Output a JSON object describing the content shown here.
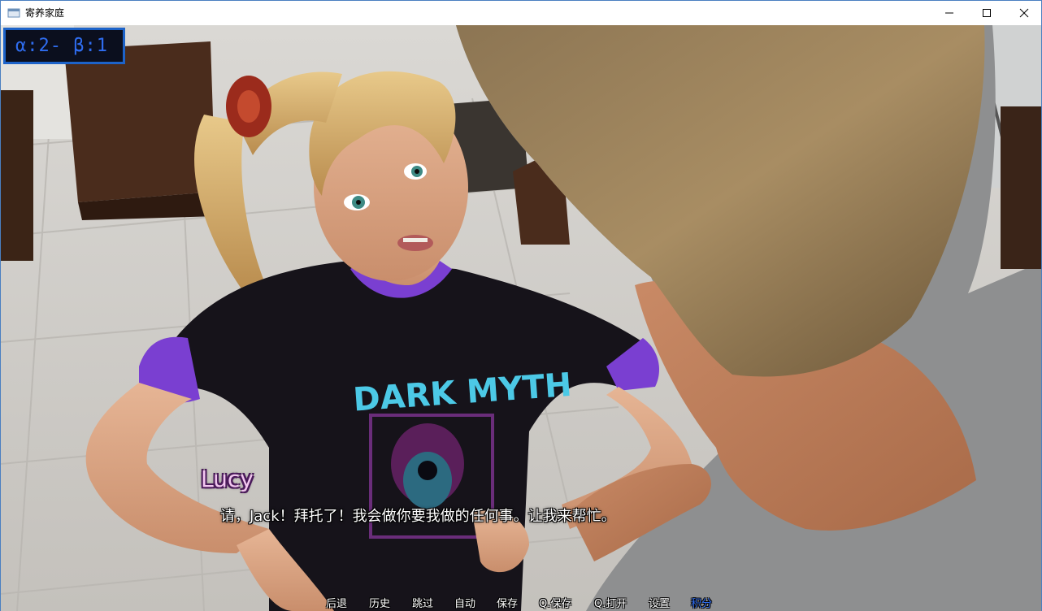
{
  "window": {
    "title": "寄养家庭"
  },
  "stats": {
    "text": "α:2- β:1",
    "color": "#2f6df0",
    "border_color": "#1d63c9"
  },
  "dialogue": {
    "speaker": "Lucy",
    "text": "请，Jack！拜托了！我会做你要我做的任何事。让我来帮忙。",
    "speaker_color": "#f2c6f0"
  },
  "quick_menu": {
    "items": [
      {
        "label": "后退",
        "name": "qm-back-button"
      },
      {
        "label": "历史",
        "name": "qm-history-button"
      },
      {
        "label": "跳过",
        "name": "qm-skip-button"
      },
      {
        "label": "自动",
        "name": "qm-auto-button"
      },
      {
        "label": "保存",
        "name": "qm-save-button"
      },
      {
        "label": "Q.保存",
        "name": "qm-quicksave-button"
      },
      {
        "label": "Q.打开",
        "name": "qm-quickload-button"
      },
      {
        "label": "设置",
        "name": "qm-settings-button"
      },
      {
        "label": "积分",
        "name": "qm-points-button"
      }
    ],
    "active_color": "#2f6df0"
  },
  "scene": {
    "shirt_text": "DARK MYTH",
    "shirt_color": "#16131a",
    "accent_color": "#7a3fd1"
  }
}
